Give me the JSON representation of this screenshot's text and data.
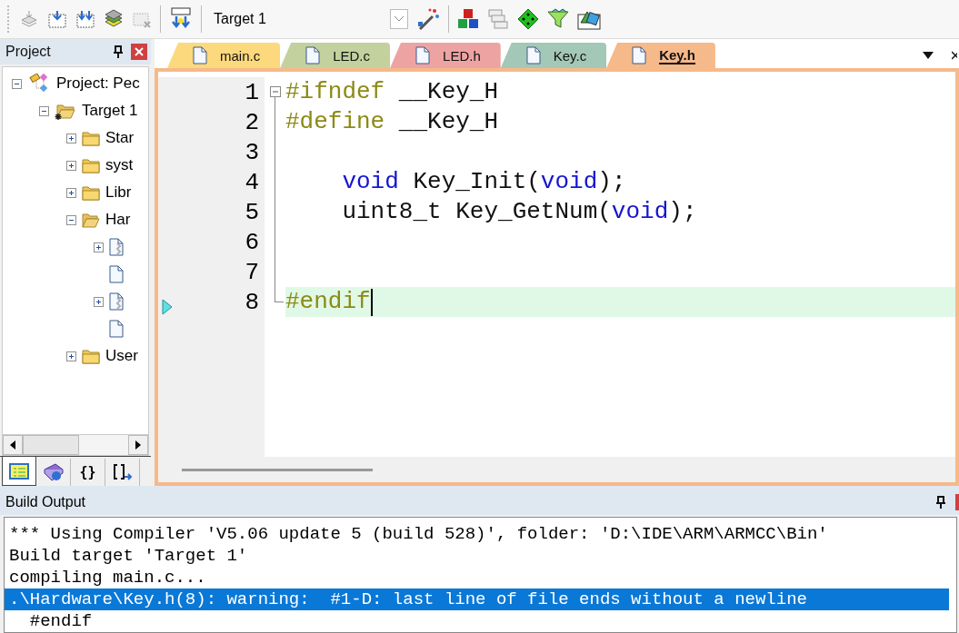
{
  "toolbar": {
    "target": "Target 1"
  },
  "project_panel": {
    "title": "Project",
    "tree": [
      {
        "kind": "project",
        "label": "Project: Pec",
        "expandable": true,
        "expanded": true,
        "children": [
          {
            "kind": "target",
            "label": "Target 1",
            "expandable": true,
            "expanded": true,
            "children": [
              {
                "kind": "folder",
                "label": "Star",
                "expandable": true,
                "expanded": false
              },
              {
                "kind": "folder",
                "label": "syst",
                "expandable": true,
                "expanded": false
              },
              {
                "kind": "folder",
                "label": "Libr",
                "expandable": true,
                "expanded": false
              },
              {
                "kind": "folder",
                "label": "Har",
                "expandable": true,
                "expanded": true,
                "children": [
                  {
                    "kind": "source",
                    "expandable": true,
                    "expanded": false
                  },
                  {
                    "kind": "header",
                    "expandable": false,
                    "expanded": false
                  },
                  {
                    "kind": "source",
                    "expandable": true,
                    "expanded": false
                  },
                  {
                    "kind": "header",
                    "expandable": false,
                    "expanded": false
                  }
                ]
              },
              {
                "kind": "folder",
                "label": "User",
                "expandable": true,
                "expanded": false
              }
            ]
          }
        ]
      }
    ],
    "tabs": [
      {
        "kind": "project",
        "selected": true
      },
      {
        "kind": "books",
        "selected": false
      },
      {
        "kind": "functions",
        "label": "{}",
        "selected": false
      },
      {
        "kind": "templates",
        "selected": false
      }
    ]
  },
  "editor": {
    "tabs": [
      {
        "label": "main.c",
        "color": "#fcd97c",
        "selected": false
      },
      {
        "label": "LED.c",
        "color": "#c2d19e",
        "selected": false
      },
      {
        "label": "LED.h",
        "color": "#eea3a3",
        "selected": false
      },
      {
        "label": "Key.c",
        "color": "#a3c8b8",
        "selected": false
      },
      {
        "label": "Key.h",
        "color": "#f6b98a",
        "selected": true
      }
    ],
    "lines": [
      {
        "number": "1",
        "fold_start": true,
        "fold_end": false,
        "indented": false,
        "current": false,
        "tokens": [
          {
            "kind": "preproc",
            "text": "#ifndef"
          },
          {
            "kind": "plain",
            "text": " __Key_H"
          }
        ]
      },
      {
        "number": "2",
        "fold_start": false,
        "fold_end": false,
        "indented": false,
        "current": false,
        "tokens": [
          {
            "kind": "preproc",
            "text": "#define"
          },
          {
            "kind": "plain",
            "text": " __Key_H"
          }
        ]
      },
      {
        "number": "3",
        "fold_start": false,
        "fold_end": false,
        "current": false
      },
      {
        "number": "4",
        "fold_start": false,
        "fold_end": false,
        "indented": true,
        "current": false,
        "tokens": [
          {
            "kind": "keyword",
            "text": "void"
          },
          {
            "kind": "plain",
            "text": " Key_Init("
          },
          {
            "kind": "keyword",
            "text": "void"
          },
          {
            "kind": "plain",
            "text": ");"
          }
        ]
      },
      {
        "number": "5",
        "fold_start": false,
        "fold_end": false,
        "indented": true,
        "current": false,
        "tokens": [
          {
            "kind": "plain",
            "text": "uint8_t Key_GetNum("
          },
          {
            "kind": "keyword",
            "text": "void"
          },
          {
            "kind": "plain",
            "text": ");"
          }
        ]
      },
      {
        "number": "6",
        "fold_start": false,
        "fold_end": false,
        "current": false
      },
      {
        "number": "7",
        "fold_start": false,
        "fold_end": false,
        "current": false
      },
      {
        "number": "8",
        "fold_start": false,
        "fold_end": true,
        "indented": false,
        "current": true,
        "tokens": [
          {
            "kind": "preproc",
            "text": "#endif"
          }
        ]
      }
    ]
  },
  "build_output": {
    "title": "Build Output",
    "lines": [
      {
        "text": "*** Using Compiler 'V5.06 update 5 (build 528)', folder: 'D:\\IDE\\ARM\\ARMCC\\Bin'",
        "selected": false
      },
      {
        "text": "Build target 'Target 1'",
        "selected": false
      },
      {
        "text": "compiling main.c...",
        "selected": false
      },
      {
        "text": ".\\Hardware\\Key.h(8): warning:  #1-D: last line of file ends without a newline",
        "selected": true
      },
      {
        "text": "  #endif",
        "selected": false
      }
    ]
  }
}
